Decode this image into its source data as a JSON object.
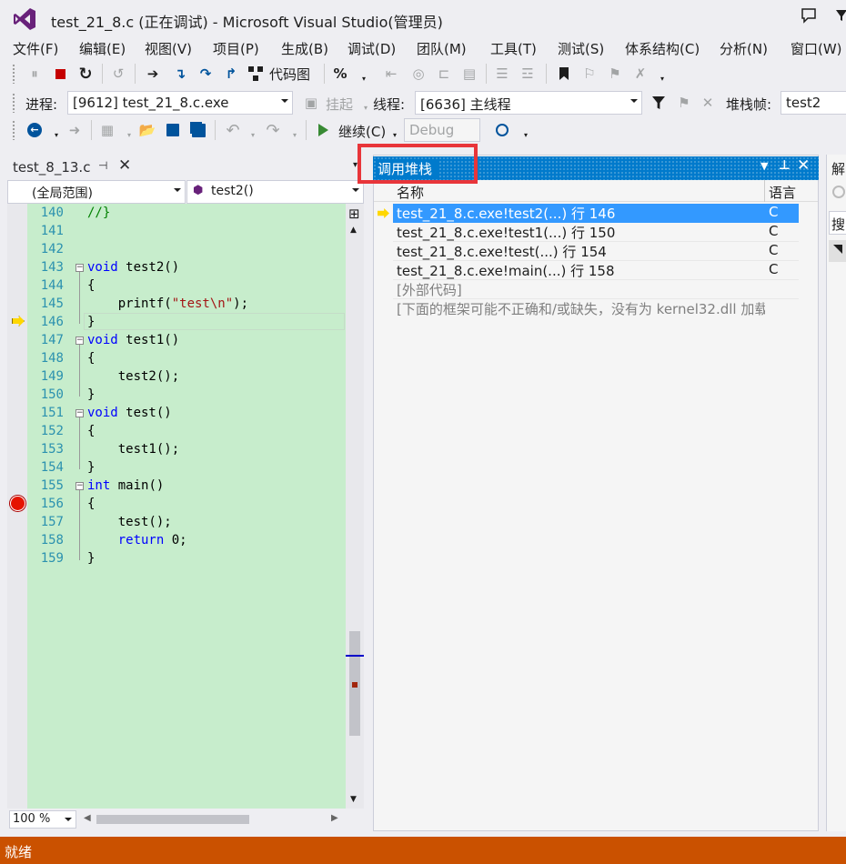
{
  "window": {
    "title": "test_21_8.c (正在调试) - Microsoft Visual Studio(管理员)"
  },
  "menu": [
    "文件(F)",
    "编辑(E)",
    "视图(V)",
    "项目(P)",
    "生成(B)",
    "调试(D)",
    "团队(M)",
    "工具(T)",
    "测试(S)",
    "体系结构(C)",
    "分析(N)",
    "窗口(W)"
  ],
  "toolbar1": {
    "code_map": "代码图"
  },
  "debug_location": {
    "process_label": "进程:",
    "process_value": "[9612] test_21_8.c.exe",
    "suspend_label": "挂起",
    "thread_label": "线程:",
    "thread_value": "[6636] 主线程",
    "frame_label": "堆栈帧:",
    "frame_value": "test2"
  },
  "toolbar3": {
    "continue_label": "继续(C)",
    "config_value": "Debug"
  },
  "editor": {
    "tab_title": "test_8_13.c",
    "scope_value": "(全局范围)",
    "member_value": "test2()",
    "zoom": "100 %",
    "lines": [
      {
        "n": "140",
        "text": "//}"
      },
      {
        "n": "141",
        "text": ""
      },
      {
        "n": "142",
        "text": ""
      },
      {
        "n": "143",
        "text": "void test2()"
      },
      {
        "n": "144",
        "text": "{"
      },
      {
        "n": "145",
        "text": "    printf(\"test\\n\");"
      },
      {
        "n": "146",
        "text": "}"
      },
      {
        "n": "147",
        "text": "void test1()"
      },
      {
        "n": "148",
        "text": "{"
      },
      {
        "n": "149",
        "text": "    test2();"
      },
      {
        "n": "150",
        "text": "}"
      },
      {
        "n": "151",
        "text": "void test()"
      },
      {
        "n": "152",
        "text": "{"
      },
      {
        "n": "153",
        "text": "    test1();"
      },
      {
        "n": "154",
        "text": "}"
      },
      {
        "n": "155",
        "text": "int main()"
      },
      {
        "n": "156",
        "text": "{"
      },
      {
        "n": "157",
        "text": "    test();"
      },
      {
        "n": "158",
        "text": "    return 0;"
      },
      {
        "n": "159",
        "text": "}"
      }
    ]
  },
  "call_stack": {
    "title": "调用堆栈",
    "col_name": "名称",
    "col_lang": "语言",
    "rows": [
      {
        "name": "test_21_8.c.exe!test2(...) 行 146",
        "lang": "C"
      },
      {
        "name": "test_21_8.c.exe!test1(...) 行 150",
        "lang": "C"
      },
      {
        "name": "test_21_8.c.exe!test(...) 行 154",
        "lang": "C"
      },
      {
        "name": "test_21_8.c.exe!main(...) 行 158",
        "lang": "C"
      },
      {
        "name": "[外部代码]",
        "lang": ""
      },
      {
        "name": "[下面的框架可能不正确和/或缺失，没有为 kernel32.dll 加载",
        "lang": ""
      }
    ]
  },
  "right_panel": {
    "title": "解",
    "search": "搜"
  },
  "status": {
    "text": "就绪"
  },
  "colors": {
    "accent": "#007acc",
    "status_bar": "#ca5100",
    "highlight_box": "#e8353a",
    "code_bg": "#c7edcc"
  }
}
